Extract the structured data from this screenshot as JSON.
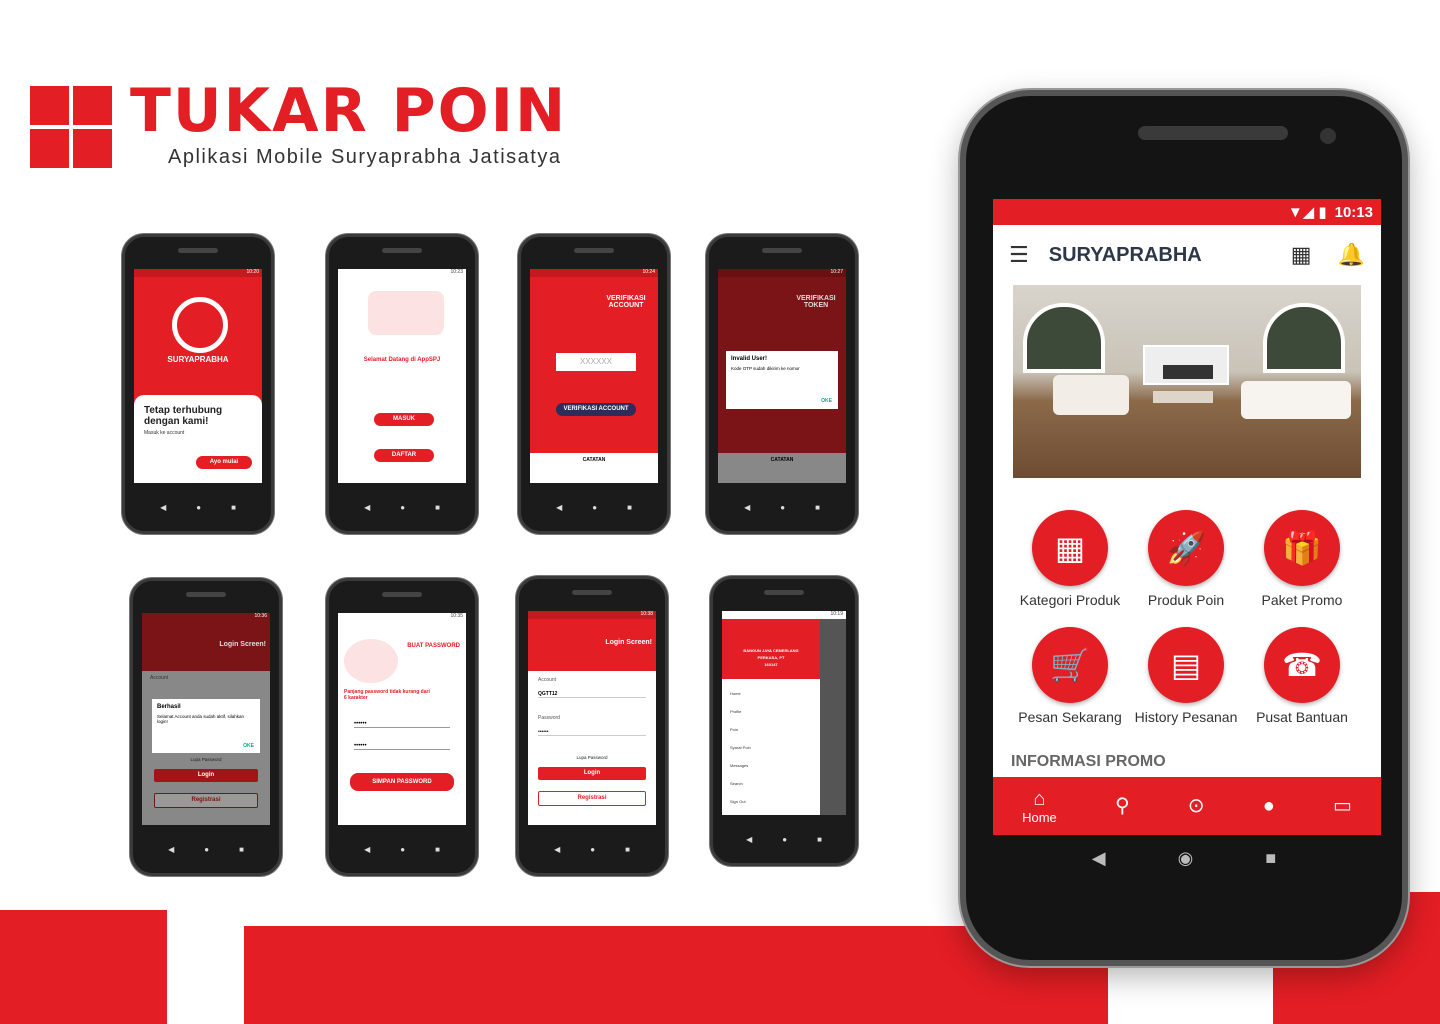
{
  "brand": {
    "title": "TUKAR POIN",
    "subtitle": "Aplikasi Mobile Suryaprabha Jatisatya"
  },
  "phones": {
    "p1": {
      "time": "10:20",
      "logo_name": "SURYAPRABHA",
      "heading": "Tetap terhubung dengan kami!",
      "sub": "Masuk ke account",
      "button": "Ayo mulai"
    },
    "p2": {
      "time": "10:23",
      "welcome": "Selamat Datang di AppSPJ",
      "btn_masuk": "MASUK",
      "btn_daftar": "DAFTAR"
    },
    "p3": {
      "time": "10:24",
      "title": "VERIFIKASI ACCOUNT",
      "placeholder": "XXXXXX",
      "button": "VERIFIKASI ACCOUNT",
      "note_title": "CATATAN"
    },
    "p4": {
      "time": "10:27",
      "title": "VERIFIKASI TOKEN",
      "dialog_title": "Invalid User!",
      "dialog_text": "Kode OTP sudah dikirim ke nomor",
      "dialog_ok": "OKE",
      "note_title": "CATATAN"
    },
    "p5": {
      "time": "10:36",
      "title": "Login Screen!",
      "dialog_title": "Berhasil",
      "dialog_text": "Selamat Account anda sudah aktif, silahkan login!",
      "dialog_ok": "OKE",
      "forgot": "Lupa Password",
      "login": "Login",
      "register": "Registrasi",
      "account_label": "Account"
    },
    "p6": {
      "time": "10:35",
      "title": "BUAT PASSWORD",
      "hint": "Panjang password tidak kurang dari 6 karakter",
      "button": "SIMPAN PASSWORD"
    },
    "p7": {
      "time": "10:38",
      "title": "Login Screen!",
      "account_label": "Account",
      "account_value": "QGTT12",
      "password_label": "Password",
      "forgot": "Lupa Password",
      "login": "Login",
      "register": "Registrasi"
    },
    "p8": {
      "time": "10:19",
      "company": "BANGUN JAYA CEMERLANG",
      "company2": "PERKASA, PT",
      "id": "160147",
      "items": [
        "Home",
        "Profile",
        "Poin",
        "Syarat Poin",
        "Messages",
        "Search",
        "Sign Out"
      ]
    }
  },
  "main": {
    "time": "10:13",
    "app_title": "SURYAPRABHA",
    "menu": [
      "Kategori Produk",
      "Produk Poin",
      "Paket Promo",
      "Pesan Sekarang",
      "History Pesanan",
      "Pusat Bantuan"
    ],
    "section_title": "INFORMASI PROMO",
    "bottom_nav": {
      "home": "Home"
    }
  },
  "colors": {
    "accent": "#e31e24",
    "dark": "#141414"
  }
}
